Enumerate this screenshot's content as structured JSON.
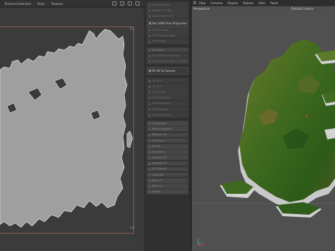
{
  "uv_editor": {
    "menu": [
      "Textured Selection",
      "Paint",
      "Textures"
    ],
    "tick_top_right": "1.1",
    "tick_bottom_right": "1.0"
  },
  "tools": {
    "items": [
      {
        "label": "Auto Mapping",
        "style": "dim"
      },
      {
        "label": "Realign UV Map",
        "style": "dim"
      },
      {
        "label": "Align Random UV",
        "style": "dim"
      },
      {
        "label": "Set UVW From Projection",
        "style": "big"
      },
      {
        "label": "Fit Rectangle",
        "style": "dim"
      },
      {
        "label": "Fit Selected Edges",
        "style": "dim"
      },
      {
        "label": "Fit Mirrored",
        "style": "dim"
      },
      {
        "label": "Fit Shape",
        "style": "normal"
      },
      {
        "label": "Fit Selected to Shape",
        "style": "dim"
      },
      {
        "label": "Fit Selected Edges to Shape",
        "style": "dim"
      },
      {
        "label": "Fit UV to Canvas",
        "style": "big"
      },
      {
        "label": "Fit UV X",
        "style": "dim"
      },
      {
        "label": "Fit UV Y",
        "style": "dim"
      },
      {
        "label": "Fit Cylinder",
        "style": "dim"
      },
      {
        "label": "Fit Rectangular",
        "style": "dim"
      },
      {
        "label": "Fit Rectangular",
        "style": "dim"
      },
      {
        "label": "Fit Spherical",
        "style": "dim"
      },
      {
        "label": "Fit Flat Camera",
        "style": "dim"
      },
      {
        "label": "Unwrapped",
        "style": "normal"
      },
      {
        "label": "Mirror Opposite",
        "style": "normal"
      },
      {
        "label": "Relaxed UV",
        "style": "normal"
      },
      {
        "label": "Fit to Grid",
        "style": "normal"
      },
      {
        "label": "Pinned",
        "style": "normal"
      },
      {
        "label": "Transform",
        "style": "normal"
      },
      {
        "label": "Smooth UV",
        "style": "normal"
      },
      {
        "label": "Average UV",
        "style": "normal"
      },
      {
        "label": "Fit Selected",
        "style": "normal"
      },
      {
        "label": "Untangle",
        "style": "normal"
      },
      {
        "label": "Weld UV",
        "style": "normal"
      },
      {
        "label": "Pack UV",
        "style": "normal"
      },
      {
        "label": "Rotate",
        "style": "normal"
      }
    ]
  },
  "viewport": {
    "menu": [
      "View",
      "Cameras",
      "Display",
      "Options",
      "Filter",
      "Panel"
    ],
    "view_name": "Perspective",
    "camera": "Default Camera"
  }
}
